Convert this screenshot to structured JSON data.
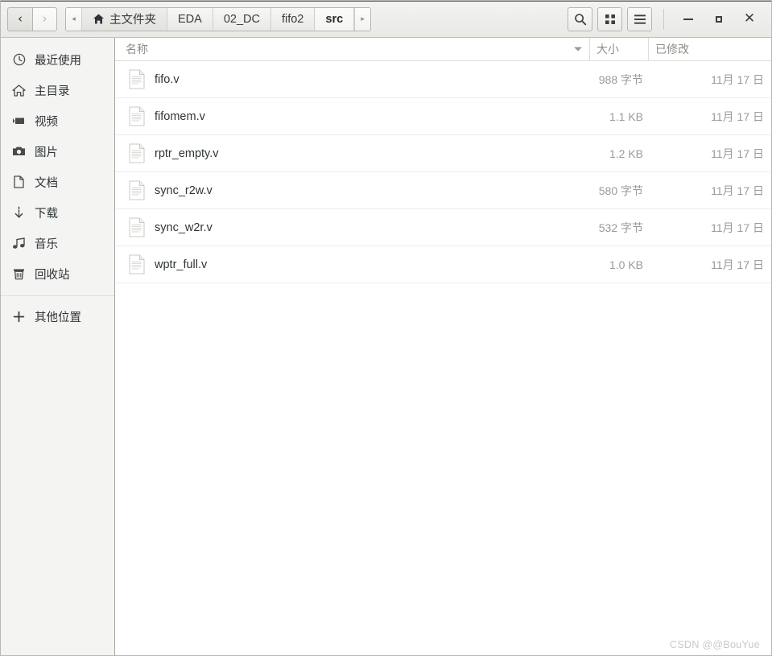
{
  "window": {
    "nav": {
      "back_label": "‹",
      "forward_label": "›"
    },
    "breadcrumb": {
      "overflow_left": "◂",
      "overflow_right": "▸",
      "items": [
        {
          "label": "主文件夹",
          "home": true,
          "active": false
        },
        {
          "label": "EDA",
          "home": false,
          "active": false
        },
        {
          "label": "02_DC",
          "home": false,
          "active": false
        },
        {
          "label": "fifo2",
          "home": false,
          "active": false
        },
        {
          "label": "src",
          "home": false,
          "active": true
        }
      ]
    },
    "tools": [
      {
        "name": "search-button",
        "icon": "search-icon"
      },
      {
        "name": "view-grid-button",
        "icon": "grid-icon"
      },
      {
        "name": "menu-button",
        "icon": "hamburger-icon"
      }
    ],
    "controls": {
      "minimize": "–",
      "maximize": "▫",
      "close": "✕"
    }
  },
  "sidebar": {
    "items": [
      {
        "label": "最近使用",
        "icon": "clock-icon",
        "name": "sidebar-item-recent"
      },
      {
        "label": "主目录",
        "icon": "home-icon",
        "name": "sidebar-item-home"
      },
      {
        "label": "视频",
        "icon": "video-icon",
        "name": "sidebar-item-videos"
      },
      {
        "label": "图片",
        "icon": "camera-icon",
        "name": "sidebar-item-pictures"
      },
      {
        "label": "文档",
        "icon": "document-icon",
        "name": "sidebar-item-documents"
      },
      {
        "label": "下载",
        "icon": "download-icon",
        "name": "sidebar-item-downloads"
      },
      {
        "label": "音乐",
        "icon": "music-icon",
        "name": "sidebar-item-music"
      },
      {
        "label": "回收站",
        "icon": "trash-icon",
        "name": "sidebar-item-trash"
      }
    ],
    "other_locations": {
      "label": "其他位置",
      "icon": "plus-icon"
    }
  },
  "columns": {
    "name": "名称",
    "size": "大小",
    "modified": "已修改",
    "sort_column": "name",
    "sort_direction": "descending"
  },
  "files": [
    {
      "name": "fifo.v",
      "size": "988 字节",
      "modified": "11月 17 日",
      "icon": "file-icon"
    },
    {
      "name": "fifomem.v",
      "size": "1.1 KB",
      "modified": "11月 17 日",
      "icon": "file-icon"
    },
    {
      "name": "rptr_empty.v",
      "size": "1.2 KB",
      "modified": "11月 17 日",
      "icon": "file-icon"
    },
    {
      "name": "sync_r2w.v",
      "size": "580 字节",
      "modified": "11月 17 日",
      "icon": "file-icon"
    },
    {
      "name": "sync_w2r.v",
      "size": "532 字节",
      "modified": "11月 17 日",
      "icon": "file-icon"
    },
    {
      "name": "wptr_full.v",
      "size": "1.0 KB",
      "modified": "11月 17 日",
      "icon": "file-icon"
    }
  ],
  "watermark": {
    "text": "CSDN @@BouYue"
  },
  "colors": {
    "sidebar_bg": "#f4f4f2",
    "content_bg": "#ffffff",
    "header_bg": "#eeeeec",
    "text": "#2e3436",
    "muted_text": "#9a9a96",
    "border": "#dcdcd8"
  }
}
